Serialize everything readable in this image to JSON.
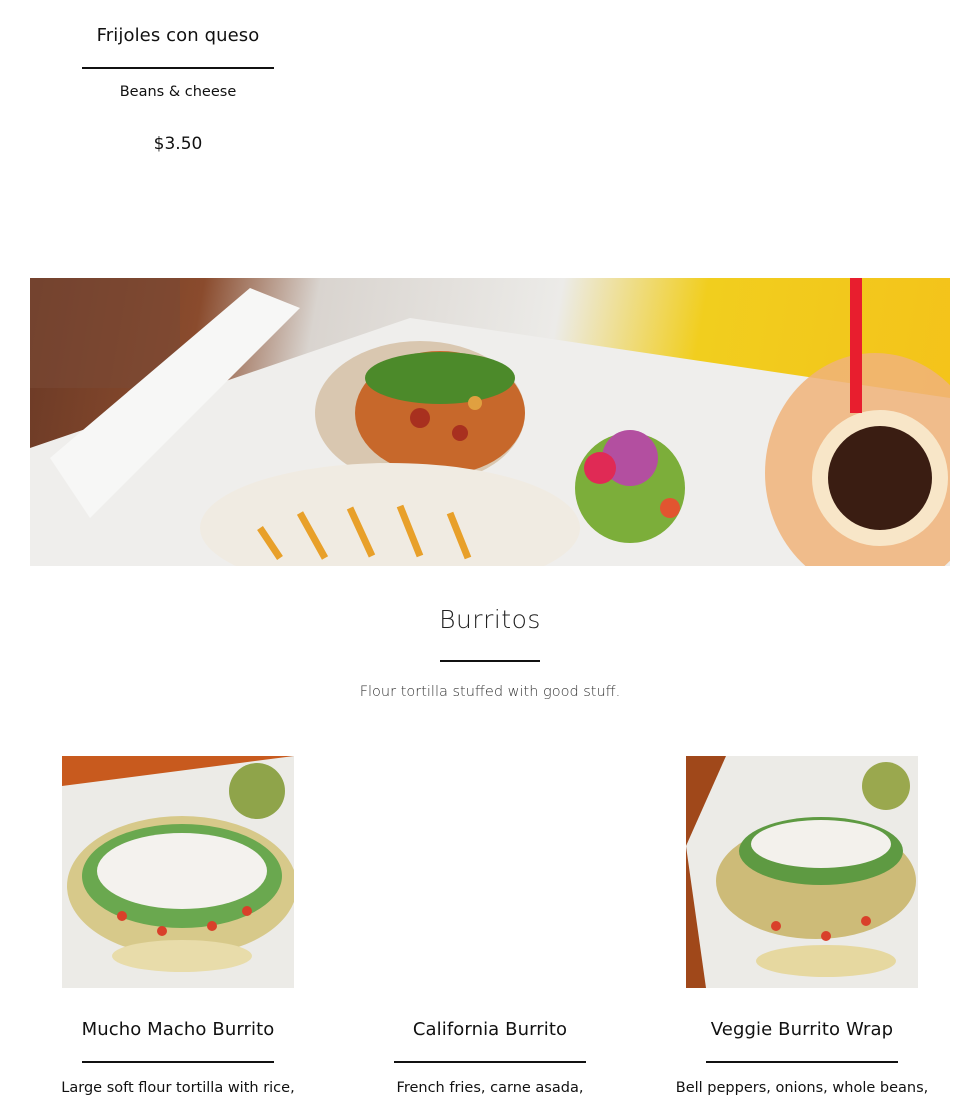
{
  "previous_item": {
    "title": "Frijoles con queso",
    "description": "Beans & cheese",
    "price": "$3.50"
  },
  "burritos_section": {
    "title": "Burritos",
    "subtitle": "Flour tortilla stuffed with good stuff.",
    "items": [
      {
        "title": "Mucho Macho Burrito",
        "description": "Large soft flour tortilla with rice,"
      },
      {
        "title": "California Burrito",
        "description": "French fries, carne asada,"
      },
      {
        "title": "Veggie Burrito Wrap",
        "description": "Bell peppers, onions, whole beans,"
      }
    ]
  },
  "colors": {
    "text": "#111111",
    "rule": "#111111",
    "background": "#ffffff"
  }
}
